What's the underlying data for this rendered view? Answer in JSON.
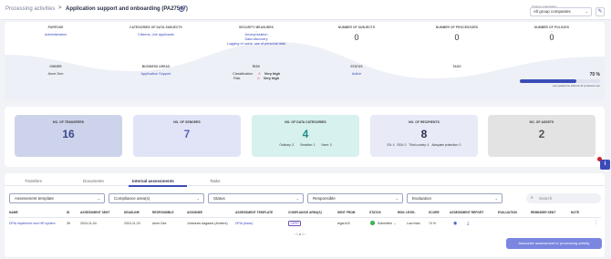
{
  "header": {
    "breadcrumb_root": "Processing activities",
    "separator": ">",
    "title": "Application support and onboarding (PA27547)",
    "info_icon": "i",
    "org_label": "Change organisation",
    "org_value": "All group companies",
    "org_caret": "⌄",
    "edit_icon": "✎"
  },
  "summary": {
    "purpose": {
      "label": "PURPOSE",
      "dash": "—",
      "value": "Administration"
    },
    "categories": {
      "label": "CATEGORIES OF DATA SUBJECTS",
      "dash": "—",
      "value": "Citizens, Job applicants"
    },
    "security": {
      "label": "SECURITY MEASURES",
      "dash": "—",
      "values": [
        "Anonymization",
        "Data discovery",
        "Logging of users' use of personal data"
      ]
    },
    "subjects": {
      "label": "NUMBER OF SUBJECTS",
      "dash": "—",
      "value": "0"
    },
    "processors": {
      "label": "NUMBER OF PROCESSORS",
      "dash": "—",
      "value": "0"
    },
    "policies": {
      "label": "NUMBER OF POLICIES",
      "dash": "—",
      "value": "0"
    },
    "owner": {
      "label": "OWNER",
      "dash": "—",
      "value": "Anne Dee"
    },
    "business_areas": {
      "label": "BUSINESS AREAS",
      "dash": "—",
      "value": "Application Support"
    },
    "risk": {
      "label": "RISK",
      "dash": "—",
      "rows": [
        {
          "name": "Classification",
          "value": "Very high",
          "icon": "⚠"
        },
        {
          "name": "Risk",
          "value": "Very high",
          "icon": "⚠"
        }
      ]
    },
    "status": {
      "label": "STATUS",
      "dash": "—",
      "value": "Active"
    },
    "tags": {
      "label": "TAGS",
      "dash": "—"
    },
    "progress": {
      "percent_label": "70 %",
      "percent": 70,
      "updated": "Last updated the 2023-04-18 by Deleted user"
    }
  },
  "stats": [
    {
      "title": "NO. OF TRANSFERS",
      "value": "16",
      "bg": "#cdd3ea",
      "color": "#3b4a8a"
    },
    {
      "title": "NO. OF SENDERS",
      "value": "7",
      "bg": "#e1e4f6",
      "color": "#5a63b8"
    },
    {
      "title": "NO. OF DATA CATEGORIES",
      "value": "4",
      "bg": "#d6f1ee",
      "color": "#1f8f86",
      "sub": [
        "Ordinary: 3",
        "Sensitive: 1",
        "None: 0"
      ]
    },
    {
      "title": "NO. OF RECIPIENTS",
      "value": "8",
      "bg": "#e8eaf7",
      "color": "#2b3148",
      "sub": [
        "EU: 4",
        "EEA: 0",
        "Third country: 4",
        "Adequate protection: 0"
      ]
    },
    {
      "title": "NO. OF ASSETS",
      "value": "2",
      "bg": "#e3e3e3",
      "color": "#555555"
    }
  ],
  "fab_icon": "i",
  "tabs": [
    "Transfers",
    "Documents",
    "Internal assessments",
    "Tasks"
  ],
  "filters": {
    "template": "Assessment template",
    "compliance": "Compliance area(s)",
    "status": "Status",
    "responsible": "Responsible",
    "evaluation": "Evaluation",
    "caret": "⌄",
    "search_placeholder": "Search",
    "search_icon": "⌕"
  },
  "table": {
    "headers": [
      "NAME",
      "ID",
      "ASSESSMENT SENT",
      "DEADLINE",
      "RESPONSIBLE",
      "ASSIGNEE",
      "ASSESSMENT TEMPLATE",
      "COMPLIANCE AREA(S)",
      "SENT FROM",
      "STATUS",
      "RISK LEVEL",
      "SCORE",
      "ASSESSMENT REPORT",
      "EVALUATION",
      "REMINDER SENT",
      "NOTE"
    ],
    "row": {
      "name": "DPIA implement new HR system",
      "id": "39",
      "sent": "2024-11-04",
      "deadline": "2024-11-20",
      "responsible": "Anne Dee",
      "assignee": "Johannes Aagaard (Ambers)",
      "template": "DPIA (basic)",
      "compliance": "GDPR",
      "sent_from": "legal A/S",
      "status": "Submitted",
      "status_caret": "⌄",
      "status_icon": "✓",
      "risk_level": "Low risks",
      "score": "74 %",
      "view_icon": "◉",
      "download_icon": "⤓",
      "more_icon": "⋮"
    },
    "pager": "‹  1 af 1  ›"
  },
  "associate_button": "Associate assessment to processing activity"
}
